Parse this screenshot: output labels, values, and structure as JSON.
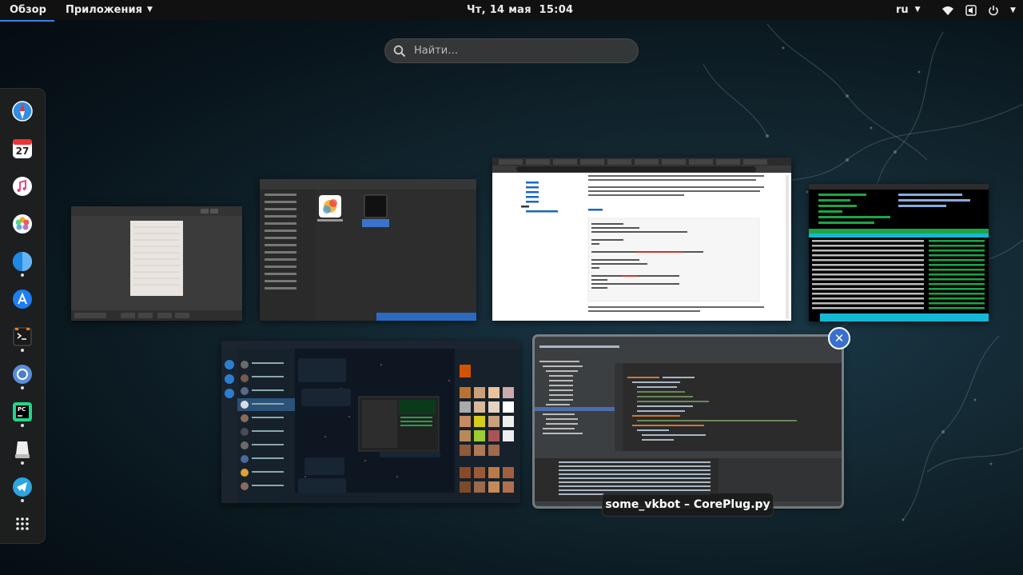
{
  "topbar": {
    "activities": "Обзор",
    "applications": "Приложения",
    "clock": "Чт, 14 мая  15:04",
    "language": "ru"
  },
  "search": {
    "placeholder": "Найти…"
  },
  "dash": {
    "apps": [
      {
        "icon": "safari-icon",
        "running": false
      },
      {
        "icon": "calendar-icon",
        "label": "27",
        "running": false
      },
      {
        "icon": "music-icon",
        "running": false
      },
      {
        "icon": "photos-icon",
        "running": false
      },
      {
        "icon": "finder-icon",
        "running": true
      },
      {
        "icon": "app-store-icon",
        "running": false
      },
      {
        "icon": "terminal-icon",
        "running": true
      },
      {
        "icon": "chrome-icon",
        "running": true
      },
      {
        "icon": "pycharm-icon",
        "label": "PC",
        "running": true
      },
      {
        "icon": "drive-icon",
        "running": true
      },
      {
        "icon": "telegram-icon",
        "running": true
      },
      {
        "icon": "app-grid-icon",
        "running": false
      }
    ]
  },
  "windows": {
    "selected_caption": "some_vkbot – CorePlug.py"
  },
  "colors": {
    "accent": "#3584e4",
    "topbar": "#111111"
  }
}
